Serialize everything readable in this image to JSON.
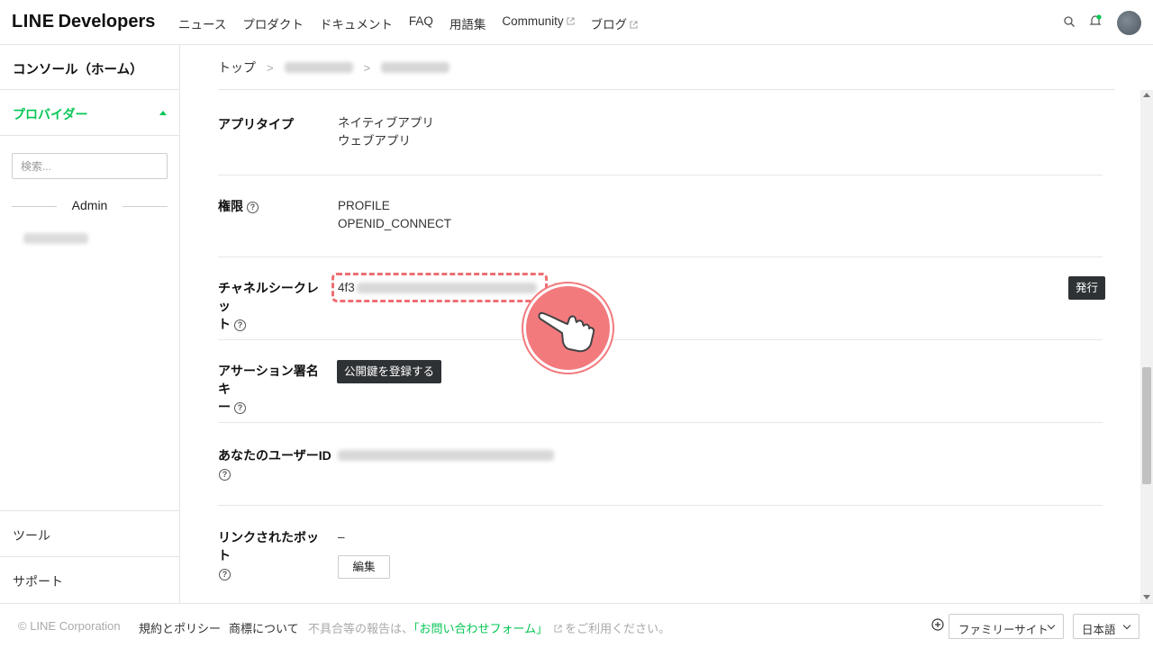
{
  "header": {
    "logo_bold": "LINE",
    "logo_light": "Developers",
    "nav": [
      "ニュース",
      "プロダクト",
      "ドキュメント",
      "FAQ",
      "用語集",
      "Community",
      "ブログ"
    ],
    "accent_color": "#06c755",
    "icons": [
      "search-icon",
      "bell-icon",
      "avatar"
    ]
  },
  "sidebar": {
    "console": "コンソール（ホーム）",
    "provider": "プロバイダー",
    "search_placeholder": "検索...",
    "admin_label": "Admin",
    "tools": "ツール",
    "support": "サポート"
  },
  "breadcrumb": {
    "top": "トップ",
    "sep": ">"
  },
  "fields": {
    "app_type": {
      "label": "アプリタイプ",
      "values": [
        "ネイティブアプリ",
        "ウェブアプリ"
      ]
    },
    "permissions": {
      "label": "権限",
      "values": [
        "PROFILE",
        "OPENID_CONNECT"
      ]
    },
    "channel_secret": {
      "label_1": "チャネルシークレッ",
      "label_2": "ト",
      "value_prefix": "4f3",
      "button": "発行"
    },
    "assertion_key": {
      "label_1": "アサーション署名キ",
      "label_2": "ー",
      "button": "公開鍵を登録する"
    },
    "user_id": {
      "label": "あなたのユーザーID"
    },
    "linked_bot": {
      "label": "リンクされたボット",
      "value": "–",
      "button": "編集"
    }
  },
  "help_glyph": "?",
  "footer": {
    "copyright": "© LINE Corporation",
    "terms": "規約とポリシー",
    "trademark": "商標について",
    "report_prefix": "不具合等の報告は、",
    "report_link": "「お問い合わせフォーム」",
    "report_suffix": "をご利用ください。",
    "family_site": "ファミリーサイト",
    "language": "日本語"
  }
}
